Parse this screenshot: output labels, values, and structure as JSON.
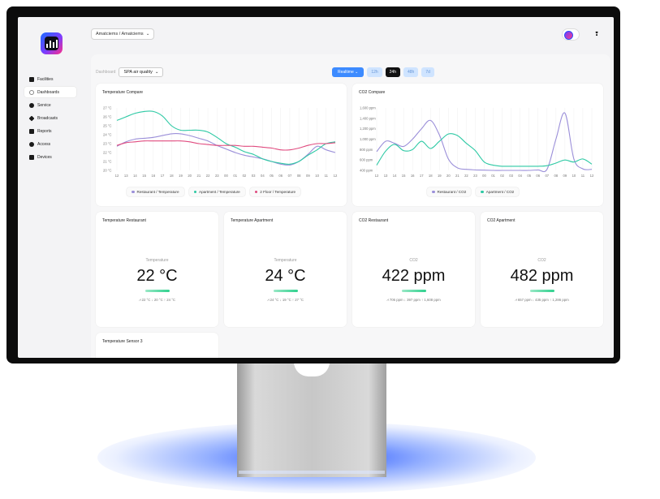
{
  "app": {
    "breadcrumb": "Amatciems / Amatciems",
    "breadcrumb_caret": "⌄",
    "bell_icon": "❢"
  },
  "sidebar": {
    "items": [
      {
        "label": "Facilities",
        "icon": "building-icon"
      },
      {
        "label": "Dashboards",
        "icon": "dashboard-icon",
        "active": true
      },
      {
        "label": "Service",
        "icon": "service-icon"
      },
      {
        "label": "Broadcasts",
        "icon": "broadcast-icon"
      },
      {
        "label": "Reports",
        "icon": "report-icon"
      },
      {
        "label": "Access",
        "icon": "access-icon"
      },
      {
        "label": "Devices",
        "icon": "devices-icon"
      }
    ]
  },
  "toolbar": {
    "dashboard_label": "Dashboard",
    "dashboard_value": "SPA air quality",
    "select_caret": "⌄",
    "realtime": "Realtime ⌄",
    "ranges": [
      "12h",
      "24h",
      "48h",
      "7d"
    ],
    "active_range": "24h"
  },
  "colors": {
    "restaurant": "#9b8fd9",
    "apartment": "#2dc9a4",
    "floor2": "#e04b7f"
  },
  "cards": {
    "temp_compare": {
      "title": "Temperature Compare",
      "legend": [
        "Restaurant / Temperature",
        "Apartment / Temperature",
        "2 Floor / Temperature"
      ]
    },
    "co2_compare": {
      "title": "CO2 Compare",
      "legend": [
        "Restaurant / CO2",
        "Apartment / CO2"
      ]
    },
    "temp_restaurant": {
      "title": "Temperature Restaurant",
      "label": "Temperature",
      "value": "22 °C",
      "stats": "⩘ 22 °C   ↓ 20 °C   ↑ 24 °C"
    },
    "temp_apartment": {
      "title": "Temperature Apartment",
      "label": "Temperature",
      "value": "24 °C",
      "stats": "⩘ 24 °C   ↓ 19 °C   ↑ 27 °C"
    },
    "co2_restaurant": {
      "title": "CO2 Restaurant",
      "label": "CO2",
      "value": "422 ppm",
      "stats": "⩘ 706 ppm   ↓ 397 ppm   ↑ 1,608 ppm"
    },
    "co2_apartment": {
      "title": "CO2 Apartment",
      "label": "CO2",
      "value": "482 ppm",
      "stats": "⩘ 657 ppm   ↓ 435 ppm   ↑ 1,286 ppm"
    },
    "temp_sensor3": {
      "title": "Temperature Sensor 3"
    }
  },
  "chart_data": [
    {
      "type": "line",
      "title": "Temperature Compare",
      "x": [
        "12",
        "13",
        "14",
        "15",
        "16",
        "17",
        "18",
        "19",
        "20",
        "21",
        "22",
        "23",
        "00",
        "01",
        "02",
        "03",
        "04",
        "05",
        "06",
        "07",
        "08",
        "09",
        "10",
        "11",
        "12"
      ],
      "y_ticks": [
        "27 °C",
        "26 °C",
        "25 °C",
        "24 °C",
        "23 °C",
        "22 °C",
        "21 °C",
        "20 °C"
      ],
      "ylim": [
        20,
        27
      ],
      "series": [
        {
          "name": "Restaurant / Temperature",
          "values": [
            22.7,
            23.2,
            23.5,
            23.6,
            23.7,
            23.9,
            24.1,
            24.1,
            23.9,
            23.6,
            23.3,
            22.8,
            22.4,
            22.0,
            21.7,
            21.5,
            21.3,
            21.0,
            20.7,
            20.6,
            21.0,
            21.8,
            22.7,
            22.3,
            22.0
          ]
        },
        {
          "name": "Apartment / Temperature",
          "values": [
            25.6,
            26.0,
            26.4,
            26.6,
            26.6,
            26.1,
            25.0,
            24.5,
            24.5,
            24.5,
            24.3,
            23.7,
            23.0,
            22.6,
            22.1,
            21.8,
            21.3,
            21.0,
            20.8,
            20.7,
            21.0,
            21.7,
            22.3,
            23.0,
            23.2
          ]
        },
        {
          "name": "2 Floor / Temperature",
          "values": [
            22.8,
            23.1,
            23.2,
            23.3,
            23.3,
            23.3,
            23.3,
            23.3,
            23.2,
            23.0,
            22.9,
            22.8,
            22.8,
            22.8,
            22.7,
            22.7,
            22.6,
            22.5,
            22.3,
            22.3,
            22.5,
            22.8,
            23.0,
            23.0,
            23.1
          ]
        }
      ]
    },
    {
      "type": "line",
      "title": "CO2 Compare",
      "x": [
        "12",
        "13",
        "14",
        "15",
        "16",
        "17",
        "18",
        "19",
        "20",
        "21",
        "22",
        "23",
        "00",
        "01",
        "02",
        "03",
        "04",
        "05",
        "06",
        "07",
        "08",
        "09",
        "10",
        "11",
        "12"
      ],
      "y_ticks": [
        "1,600 ppm",
        "1,400 ppm",
        "1,200 ppm",
        "1,000 ppm",
        "800 ppm",
        "600 ppm",
        "400 ppm"
      ],
      "ylim": [
        400,
        1600
      ],
      "series": [
        {
          "name": "Restaurant / CO2",
          "values": [
            760,
            960,
            920,
            860,
            1000,
            1200,
            1360,
            1080,
            620,
            450,
            420,
            410,
            405,
            400,
            400,
            400,
            400,
            400,
            410,
            420,
            1000,
            1500,
            620,
            430,
            420
          ]
        },
        {
          "name": "Apartment / CO2",
          "values": [
            500,
            770,
            900,
            780,
            800,
            960,
            820,
            960,
            1100,
            1070,
            920,
            780,
            560,
            500,
            480,
            480,
            480,
            480,
            480,
            490,
            540,
            600,
            560,
            620,
            520
          ]
        }
      ]
    }
  ]
}
